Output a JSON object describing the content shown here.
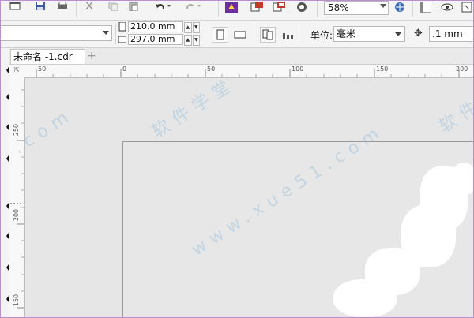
{
  "toolbar": {
    "zoom_value": "58%"
  },
  "property_bar": {
    "width_value": "210.0 mm",
    "height_value": "297.0 mm",
    "units_label": "单位:",
    "units_value": "毫米",
    "nudge_value": ".1 mm"
  },
  "tabs": {
    "document_tab": "未命名 -1.cdr",
    "add_tab_glyph": "+"
  },
  "ruler": {
    "top_labels": [
      "50",
      "0",
      "50",
      "100",
      "150",
      "200"
    ],
    "left_labels": [
      "250",
      "200",
      "150"
    ]
  },
  "watermark": {
    "text_1": "软件学堂",
    "text_2": "www.xue51.com",
    "text_3": ".com",
    "text_4": "软件"
  },
  "colors": {
    "frame_border": "#b98fcf",
    "canvas": "#e6e6e6",
    "accent_purple": "#6b2fa0"
  }
}
